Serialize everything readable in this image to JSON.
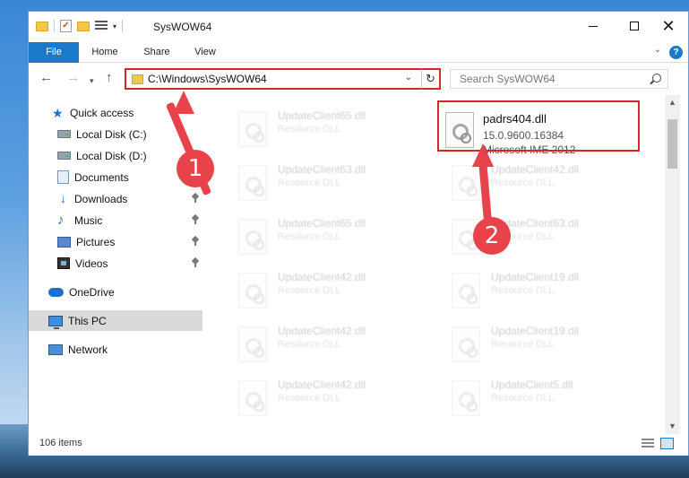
{
  "window": {
    "title": "SysWOW64",
    "ribbon_tabs": [
      "File",
      "Home",
      "Share",
      "View"
    ],
    "help": "?"
  },
  "address_bar": {
    "path": "C:\\Windows\\SysWOW64",
    "search_placeholder": "Search SysWOW64"
  },
  "sidebar": {
    "items": [
      {
        "label": "Quick access",
        "icon": "star-icon"
      },
      {
        "label": "Local Disk (C:)",
        "icon": "disk-icon"
      },
      {
        "label": "Local Disk (D:)",
        "icon": "disk-icon"
      },
      {
        "label": "Documents",
        "icon": "documents-icon",
        "pinned": true
      },
      {
        "label": "Downloads",
        "icon": "download-icon",
        "pinned": true
      },
      {
        "label": "Music",
        "icon": "music-icon",
        "pinned": true
      },
      {
        "label": "Pictures",
        "icon": "pictures-icon",
        "pinned": true
      },
      {
        "label": "Videos",
        "icon": "videos-icon",
        "pinned": true
      },
      {
        "label": "OneDrive",
        "icon": "cloud-icon"
      },
      {
        "label": "This PC",
        "icon": "pc-icon",
        "selected": true
      },
      {
        "label": "Network",
        "icon": "network-icon"
      }
    ]
  },
  "files": {
    "left_column": [
      {
        "name": "UpdateClient65.dll",
        "type": "Resource DLL"
      },
      {
        "name": "UpdateClient63.dll",
        "type": "Resource DLL"
      },
      {
        "name": "UpdateClient65.dll",
        "type": "Resource DLL"
      },
      {
        "name": "UpdateClient42.dll",
        "type": "Resource DLL"
      },
      {
        "name": "UpdateClient42.dll",
        "type": "Resource DLL"
      },
      {
        "name": "UpdateClient42.dll",
        "type": "Resource DLL"
      }
    ],
    "right_column": [
      {
        "name": "UpdateClient42.dll",
        "type": "Resource DLL"
      },
      {
        "name": "UpdateClient63.dll",
        "type": "Resource DLL"
      },
      {
        "name": "UpdateClient19.dll",
        "type": "Resource DLL"
      },
      {
        "name": "UpdateClient19.dll",
        "type": "Resource DLL"
      },
      {
        "name": "UpdateClient5.dll",
        "type": "Resource DLL"
      }
    ],
    "highlighted": {
      "name": "padrs404.dll",
      "version": "15.0.9600.16384",
      "description": "Microsoft IME 2012"
    }
  },
  "status": {
    "item_count": "106 items"
  },
  "annotations": {
    "step1": "1",
    "step2": "2",
    "color": "#e8434a"
  }
}
